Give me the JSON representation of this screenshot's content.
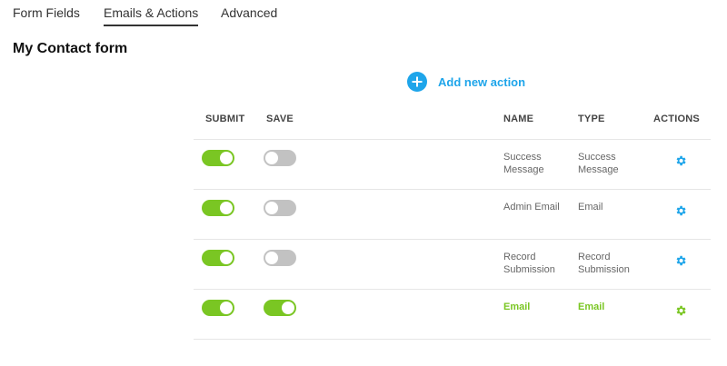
{
  "tabs": [
    {
      "label": "Form Fields"
    },
    {
      "label": "Emails & Actions",
      "active": true
    },
    {
      "label": "Advanced"
    }
  ],
  "page_title": "My Contact form",
  "add_action_label": "Add new action",
  "columns": {
    "submit": "SUBMIT",
    "save": "SAVE",
    "name": "NAME",
    "type": "TYPE",
    "actions": "ACTIONS"
  },
  "rows": [
    {
      "submit": true,
      "save": false,
      "name": "Success Message",
      "type": "Success Message",
      "highlighted": false
    },
    {
      "submit": true,
      "save": false,
      "name": "Admin Email",
      "type": "Email",
      "highlighted": false
    },
    {
      "submit": true,
      "save": false,
      "name": "Record Submission",
      "type": "Record Submission",
      "highlighted": false
    },
    {
      "submit": true,
      "save": true,
      "name": "Email",
      "type": "Email",
      "highlighted": true
    }
  ],
  "colors": {
    "accent": "#1ea5ea",
    "toggle_on": "#7ac623",
    "toggle_off": "#c2c2c2",
    "highlight_text": "#7ac623"
  },
  "icons": {
    "add": "plus-circle-icon",
    "settings": "gear-icon"
  }
}
